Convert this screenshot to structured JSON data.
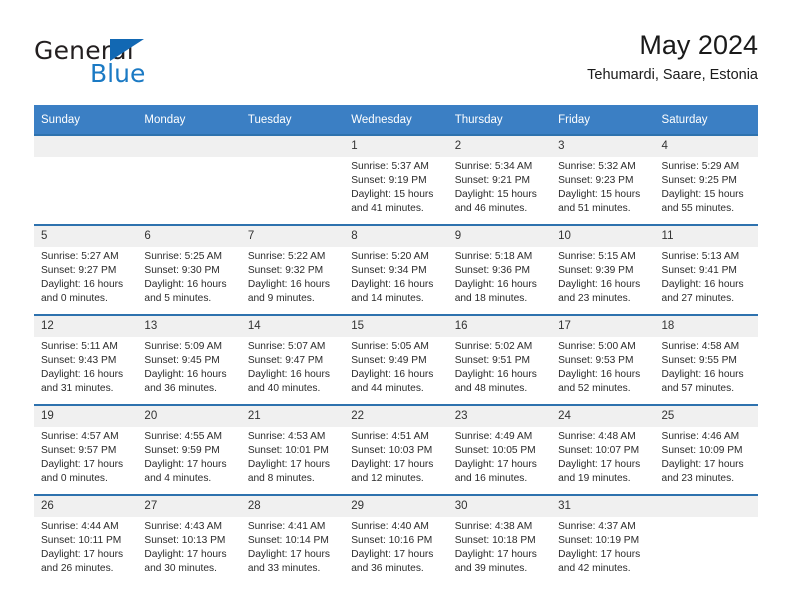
{
  "brand": {
    "name_part1": "General",
    "name_part2": "Blue",
    "logo_icon": "triangle-logo-icon",
    "color_dark": "#231f20",
    "color_blue": "#1b7ac4"
  },
  "header": {
    "title": "May 2024",
    "subtitle": "Tehumardi, Saare, Estonia"
  },
  "calendar": {
    "header_bg": "#3b7fc4",
    "row_line_color": "#2e72ae",
    "daynum_bg": "#f0f0f0",
    "weekday_labels": [
      "Sunday",
      "Monday",
      "Tuesday",
      "Wednesday",
      "Thursday",
      "Friday",
      "Saturday"
    ],
    "weeks": [
      [
        {
          "day": "",
          "sunrise": "",
          "sunset": "",
          "daylight1": "",
          "daylight2": ""
        },
        {
          "day": "",
          "sunrise": "",
          "sunset": "",
          "daylight1": "",
          "daylight2": ""
        },
        {
          "day": "",
          "sunrise": "",
          "sunset": "",
          "daylight1": "",
          "daylight2": ""
        },
        {
          "day": "1",
          "sunrise": "Sunrise: 5:37 AM",
          "sunset": "Sunset: 9:19 PM",
          "daylight1": "Daylight: 15 hours",
          "daylight2": "and 41 minutes."
        },
        {
          "day": "2",
          "sunrise": "Sunrise: 5:34 AM",
          "sunset": "Sunset: 9:21 PM",
          "daylight1": "Daylight: 15 hours",
          "daylight2": "and 46 minutes."
        },
        {
          "day": "3",
          "sunrise": "Sunrise: 5:32 AM",
          "sunset": "Sunset: 9:23 PM",
          "daylight1": "Daylight: 15 hours",
          "daylight2": "and 51 minutes."
        },
        {
          "day": "4",
          "sunrise": "Sunrise: 5:29 AM",
          "sunset": "Sunset: 9:25 PM",
          "daylight1": "Daylight: 15 hours",
          "daylight2": "and 55 minutes."
        }
      ],
      [
        {
          "day": "5",
          "sunrise": "Sunrise: 5:27 AM",
          "sunset": "Sunset: 9:27 PM",
          "daylight1": "Daylight: 16 hours",
          "daylight2": "and 0 minutes."
        },
        {
          "day": "6",
          "sunrise": "Sunrise: 5:25 AM",
          "sunset": "Sunset: 9:30 PM",
          "daylight1": "Daylight: 16 hours",
          "daylight2": "and 5 minutes."
        },
        {
          "day": "7",
          "sunrise": "Sunrise: 5:22 AM",
          "sunset": "Sunset: 9:32 PM",
          "daylight1": "Daylight: 16 hours",
          "daylight2": "and 9 minutes."
        },
        {
          "day": "8",
          "sunrise": "Sunrise: 5:20 AM",
          "sunset": "Sunset: 9:34 PM",
          "daylight1": "Daylight: 16 hours",
          "daylight2": "and 14 minutes."
        },
        {
          "day": "9",
          "sunrise": "Sunrise: 5:18 AM",
          "sunset": "Sunset: 9:36 PM",
          "daylight1": "Daylight: 16 hours",
          "daylight2": "and 18 minutes."
        },
        {
          "day": "10",
          "sunrise": "Sunrise: 5:15 AM",
          "sunset": "Sunset: 9:39 PM",
          "daylight1": "Daylight: 16 hours",
          "daylight2": "and 23 minutes."
        },
        {
          "day": "11",
          "sunrise": "Sunrise: 5:13 AM",
          "sunset": "Sunset: 9:41 PM",
          "daylight1": "Daylight: 16 hours",
          "daylight2": "and 27 minutes."
        }
      ],
      [
        {
          "day": "12",
          "sunrise": "Sunrise: 5:11 AM",
          "sunset": "Sunset: 9:43 PM",
          "daylight1": "Daylight: 16 hours",
          "daylight2": "and 31 minutes."
        },
        {
          "day": "13",
          "sunrise": "Sunrise: 5:09 AM",
          "sunset": "Sunset: 9:45 PM",
          "daylight1": "Daylight: 16 hours",
          "daylight2": "and 36 minutes."
        },
        {
          "day": "14",
          "sunrise": "Sunrise: 5:07 AM",
          "sunset": "Sunset: 9:47 PM",
          "daylight1": "Daylight: 16 hours",
          "daylight2": "and 40 minutes."
        },
        {
          "day": "15",
          "sunrise": "Sunrise: 5:05 AM",
          "sunset": "Sunset: 9:49 PM",
          "daylight1": "Daylight: 16 hours",
          "daylight2": "and 44 minutes."
        },
        {
          "day": "16",
          "sunrise": "Sunrise: 5:02 AM",
          "sunset": "Sunset: 9:51 PM",
          "daylight1": "Daylight: 16 hours",
          "daylight2": "and 48 minutes."
        },
        {
          "day": "17",
          "sunrise": "Sunrise: 5:00 AM",
          "sunset": "Sunset: 9:53 PM",
          "daylight1": "Daylight: 16 hours",
          "daylight2": "and 52 minutes."
        },
        {
          "day": "18",
          "sunrise": "Sunrise: 4:58 AM",
          "sunset": "Sunset: 9:55 PM",
          "daylight1": "Daylight: 16 hours",
          "daylight2": "and 57 minutes."
        }
      ],
      [
        {
          "day": "19",
          "sunrise": "Sunrise: 4:57 AM",
          "sunset": "Sunset: 9:57 PM",
          "daylight1": "Daylight: 17 hours",
          "daylight2": "and 0 minutes."
        },
        {
          "day": "20",
          "sunrise": "Sunrise: 4:55 AM",
          "sunset": "Sunset: 9:59 PM",
          "daylight1": "Daylight: 17 hours",
          "daylight2": "and 4 minutes."
        },
        {
          "day": "21",
          "sunrise": "Sunrise: 4:53 AM",
          "sunset": "Sunset: 10:01 PM",
          "daylight1": "Daylight: 17 hours",
          "daylight2": "and 8 minutes."
        },
        {
          "day": "22",
          "sunrise": "Sunrise: 4:51 AM",
          "sunset": "Sunset: 10:03 PM",
          "daylight1": "Daylight: 17 hours",
          "daylight2": "and 12 minutes."
        },
        {
          "day": "23",
          "sunrise": "Sunrise: 4:49 AM",
          "sunset": "Sunset: 10:05 PM",
          "daylight1": "Daylight: 17 hours",
          "daylight2": "and 16 minutes."
        },
        {
          "day": "24",
          "sunrise": "Sunrise: 4:48 AM",
          "sunset": "Sunset: 10:07 PM",
          "daylight1": "Daylight: 17 hours",
          "daylight2": "and 19 minutes."
        },
        {
          "day": "25",
          "sunrise": "Sunrise: 4:46 AM",
          "sunset": "Sunset: 10:09 PM",
          "daylight1": "Daylight: 17 hours",
          "daylight2": "and 23 minutes."
        }
      ],
      [
        {
          "day": "26",
          "sunrise": "Sunrise: 4:44 AM",
          "sunset": "Sunset: 10:11 PM",
          "daylight1": "Daylight: 17 hours",
          "daylight2": "and 26 minutes."
        },
        {
          "day": "27",
          "sunrise": "Sunrise: 4:43 AM",
          "sunset": "Sunset: 10:13 PM",
          "daylight1": "Daylight: 17 hours",
          "daylight2": "and 30 minutes."
        },
        {
          "day": "28",
          "sunrise": "Sunrise: 4:41 AM",
          "sunset": "Sunset: 10:14 PM",
          "daylight1": "Daylight: 17 hours",
          "daylight2": "and 33 minutes."
        },
        {
          "day": "29",
          "sunrise": "Sunrise: 4:40 AM",
          "sunset": "Sunset: 10:16 PM",
          "daylight1": "Daylight: 17 hours",
          "daylight2": "and 36 minutes."
        },
        {
          "day": "30",
          "sunrise": "Sunrise: 4:38 AM",
          "sunset": "Sunset: 10:18 PM",
          "daylight1": "Daylight: 17 hours",
          "daylight2": "and 39 minutes."
        },
        {
          "day": "31",
          "sunrise": "Sunrise: 4:37 AM",
          "sunset": "Sunset: 10:19 PM",
          "daylight1": "Daylight: 17 hours",
          "daylight2": "and 42 minutes."
        },
        {
          "day": "",
          "sunrise": "",
          "sunset": "",
          "daylight1": "",
          "daylight2": ""
        }
      ]
    ]
  }
}
